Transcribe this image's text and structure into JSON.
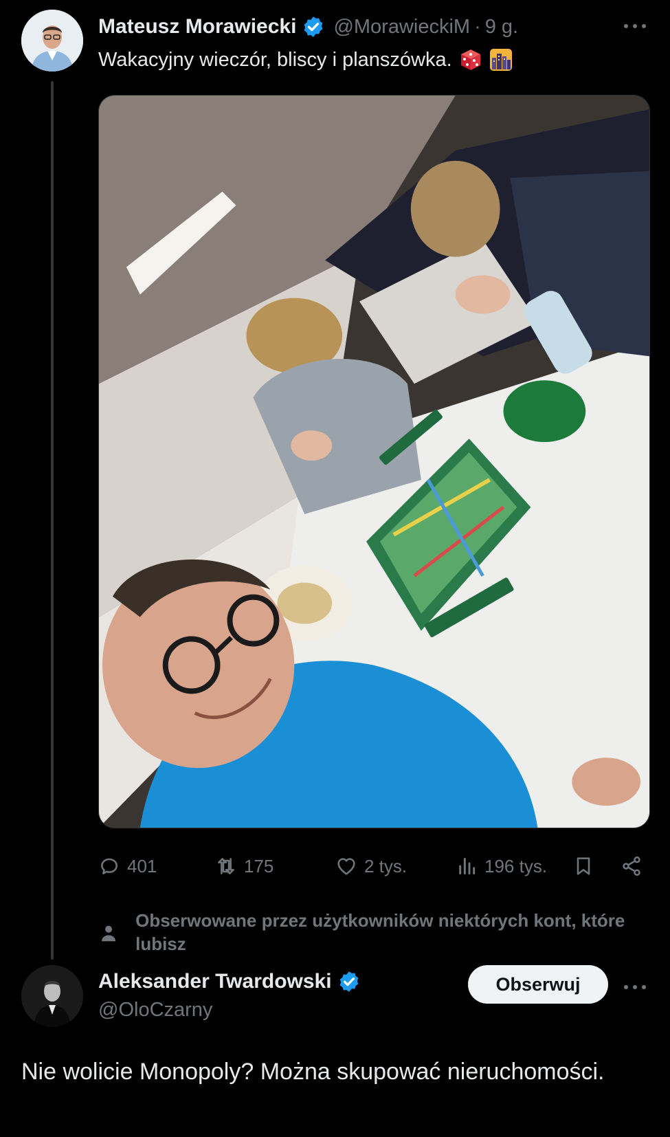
{
  "tweet": {
    "author_name": "Mateusz Morawiecki",
    "author_handle": "@MorawieckiM",
    "separator": "·",
    "time": "9 g.",
    "text": "Wakacyjny wieczór, bliscy i planszówka.",
    "emojis": [
      "dice-emoji",
      "night-city-emoji"
    ],
    "stats": {
      "replies": "401",
      "reposts": "175",
      "likes": "2 tys.",
      "views": "196 tys."
    },
    "followed_by_note": "Obserwowane przez użytkowników niektórych kont, które lubisz"
  },
  "reply": {
    "author_name": "Aleksander Twardowski",
    "author_handle": "@OloCzarny",
    "follow_label": "Obserwuj",
    "text": "Nie wolicie Monopoly? Można skupować nieruchomości."
  },
  "colors": {
    "background": "#000000",
    "text": "#e7e9ea",
    "muted": "#71767b",
    "verified": "#1d9bf0",
    "follow_button": "#eff3f4"
  },
  "icons": [
    "verified-badge-icon",
    "more-icon",
    "reply-icon",
    "repost-icon",
    "like-icon",
    "views-icon",
    "bookmark-icon",
    "share-icon",
    "person-icon"
  ]
}
